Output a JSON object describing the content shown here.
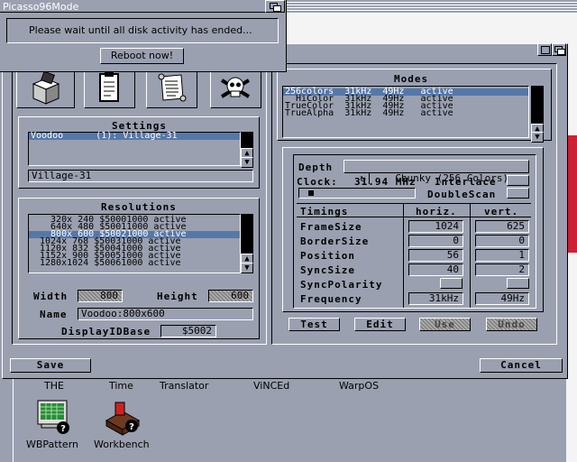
{
  "screen": {
    "bg_color": "#9aa0b0"
  },
  "requester": {
    "title": "Picasso96Mode",
    "message": "Please wait until all disk activity has ended...",
    "reboot_label": "Reboot now!"
  },
  "toolbar": {
    "icons": [
      "disk-box-icon",
      "clipboard-icon",
      "scroll-icon",
      "skull-icon"
    ]
  },
  "settings": {
    "title": "Settings",
    "items": [
      {
        "name": "Voodoo",
        "detail": "(1): Village-31"
      }
    ],
    "current": "Village-31"
  },
  "resolutions": {
    "title": "Resolutions",
    "items": [
      "  320x 240 $50001000 active",
      "  640x 480 $50011000 active",
      "  800x 600 $50021000 active",
      "1024x 768 $50031000 active",
      "1120x 832 $50041000 active",
      "1152x 900 $50051000 active",
      "1280x1024 $50061000 active"
    ],
    "selected_index": 2,
    "width_label": "Width",
    "width_value": "800",
    "height_label": "Height",
    "height_value": "600",
    "name_label": "Name",
    "name_value": "Voodoo:800x600",
    "displayid_label": "DisplayIDBase",
    "displayid_value": "$5002"
  },
  "modes": {
    "title": "Modes",
    "items": [
      "256colors  31kHz  49Hz   active",
      "  HiColor  31kHz  49Hz   active",
      "TrueColor  31kHz  49Hz   active",
      "TrueAlpha  31kHz  49Hz   active"
    ],
    "selected_index": 0
  },
  "detail": {
    "depth_label": "Depth",
    "depth_value": "Chunky (256 Colors)",
    "clock_label": "Clock:",
    "clock_value": "31.94 MHz",
    "interlace_label": "Interlace",
    "doublescan_label": "DoubleScan",
    "timings_label": "Timings",
    "horiz_label": "horiz.",
    "vert_label": "vert.",
    "rows": [
      {
        "label": "FrameSize",
        "h": "1024",
        "v": "625"
      },
      {
        "label": "BorderSize",
        "h": "0",
        "v": "0"
      },
      {
        "label": "Position",
        "h": "56",
        "v": "1"
      },
      {
        "label": "SyncSize",
        "h": "40",
        "v": "2"
      },
      {
        "label": "SyncPolarity",
        "h": "",
        "v": ""
      },
      {
        "label": "Frequency",
        "h": "31kHz",
        "v": "49Hz"
      }
    ],
    "test_label": "Test",
    "edit_label": "Edit",
    "use_label": "Use",
    "undo_label": "Undo"
  },
  "bottom": {
    "save_label": "Save",
    "cancel_label": "Cancel"
  },
  "desktop": {
    "text_row": [
      "THE",
      "Time",
      "Translator",
      "ViNCEd",
      "WarpOS"
    ],
    "icons": [
      {
        "name": "wbpattern-icon",
        "label": "WBPattern"
      },
      {
        "name": "workbench-icon",
        "label": "Workbench"
      }
    ]
  }
}
